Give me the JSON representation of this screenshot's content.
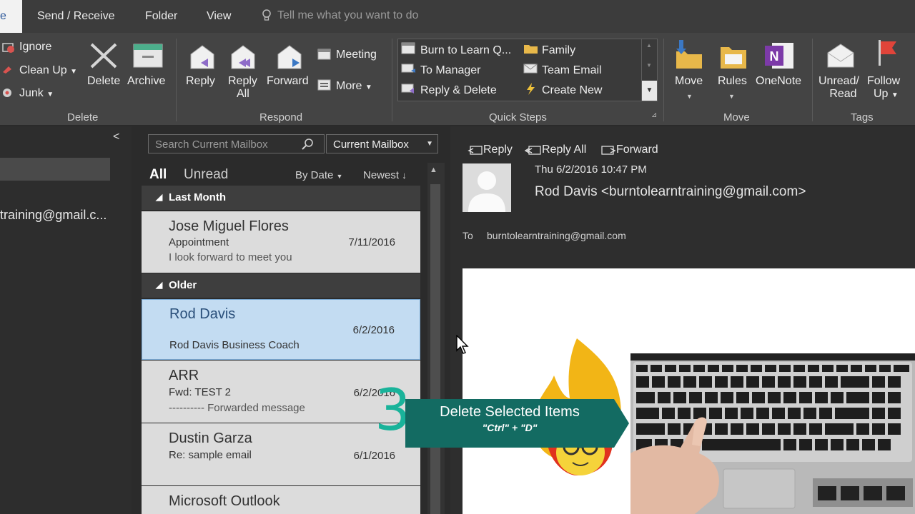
{
  "menubar": {
    "home_tab": "e",
    "tabs": [
      "Send / Receive",
      "Folder",
      "View"
    ],
    "tell_me": "Tell me what you want to do"
  },
  "ribbon": {
    "delete_group": {
      "ignore": "Ignore",
      "clean_up": "Clean Up",
      "junk": "Junk",
      "delete": "Delete",
      "archive": "Archive",
      "label": "Delete"
    },
    "respond_group": {
      "reply": "Reply",
      "reply_all_1": "Reply",
      "reply_all_2": "All",
      "forward": "Forward",
      "meeting": "Meeting",
      "more": "More",
      "label": "Respond"
    },
    "quick_steps": {
      "items": [
        "Burn to Learn Q...",
        "To Manager",
        "Reply & Delete",
        "Family",
        "Team Email",
        "Create New"
      ],
      "label": "Quick Steps"
    },
    "move_group": {
      "move": "Move",
      "rules": "Rules",
      "onenote": "OneNote",
      "label": "Move"
    },
    "tags_group": {
      "unread_read_1": "Unread/",
      "unread_read_2": "Read",
      "follow_up_1": "Follow",
      "follow_up_2": "Up",
      "label": "Tags"
    }
  },
  "folder_pane": {
    "account": "training@gmail.c..."
  },
  "message_list": {
    "search_placeholder": "Search Current Mailbox",
    "scope": "Current Mailbox",
    "filter_all": "All",
    "filter_unread": "Unread",
    "sort_by": "By Date",
    "sort_order": "Newest",
    "groups": [
      {
        "header": "Last Month",
        "items": [
          {
            "sender": "Jose Miguel Flores",
            "subject": "Appointment",
            "preview": "I look forward to meet you",
            "date": "7/11/2016"
          }
        ]
      },
      {
        "header": "Older",
        "items": [
          {
            "sender": "Rod Davis",
            "subject": "",
            "preview": "Rod Davis  Business Coach",
            "date": "6/2/2016"
          },
          {
            "sender": "ARR",
            "subject": "Fwd: TEST 2",
            "preview": "---------- Forwarded message",
            "date": "6/2/2016"
          },
          {
            "sender": "Dustin Garza",
            "subject": "Re: sample email",
            "preview": "",
            "date": "6/1/2016"
          },
          {
            "sender": "Microsoft Outlook",
            "subject": "",
            "preview": "",
            "date": ""
          }
        ]
      }
    ]
  },
  "reading_pane": {
    "actions": {
      "reply": "Reply",
      "reply_all": "Reply All",
      "forward": "Forward"
    },
    "date": "Thu 6/2/2016 10:47 PM",
    "from": "Rod Davis <burntolearntraining@gmail.com>",
    "to_label": "To",
    "to": "burntolearntraining@gmail.com"
  },
  "overlay": {
    "number": "3",
    "title": "Delete Selected Items",
    "keys": "\"Ctrl\" + \"D\""
  },
  "colors": {
    "accent_teal": "#19b39a",
    "overlay_bg": "#136b62",
    "selected_item": "#c3dcf2",
    "outlook_blue": "#2b579a"
  }
}
